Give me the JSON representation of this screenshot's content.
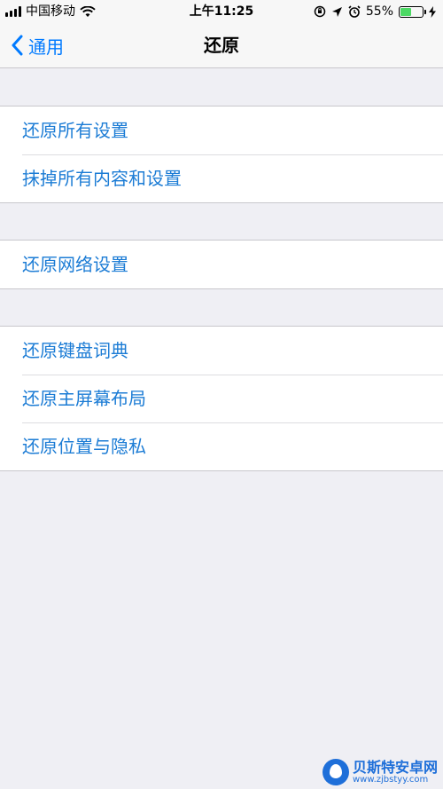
{
  "status_bar": {
    "carrier": "中国移动",
    "time": "上午11:25",
    "battery_percent": "55%",
    "battery_level": 0.55,
    "icons": [
      "signal-icon",
      "wifi-icon",
      "orientation-lock-icon",
      "location-icon",
      "alarm-icon",
      "battery-icon",
      "charging-icon"
    ]
  },
  "nav": {
    "back_label": "通用",
    "title": "还原"
  },
  "groups": [
    {
      "items": [
        "还原所有设置",
        "抹掉所有内容和设置"
      ]
    },
    {
      "items": [
        "还原网络设置"
      ]
    },
    {
      "items": [
        "还原键盘词典",
        "还原主屏幕布局",
        "还原位置与隐私"
      ]
    }
  ],
  "colors": {
    "accent": "#007AFF",
    "row_text": "#1C7CD5",
    "background": "#EFEFF4",
    "battery_fill": "#4CD964"
  },
  "watermark": {
    "title": "贝斯特安卓网",
    "url": "www.zjbstyy.com"
  }
}
